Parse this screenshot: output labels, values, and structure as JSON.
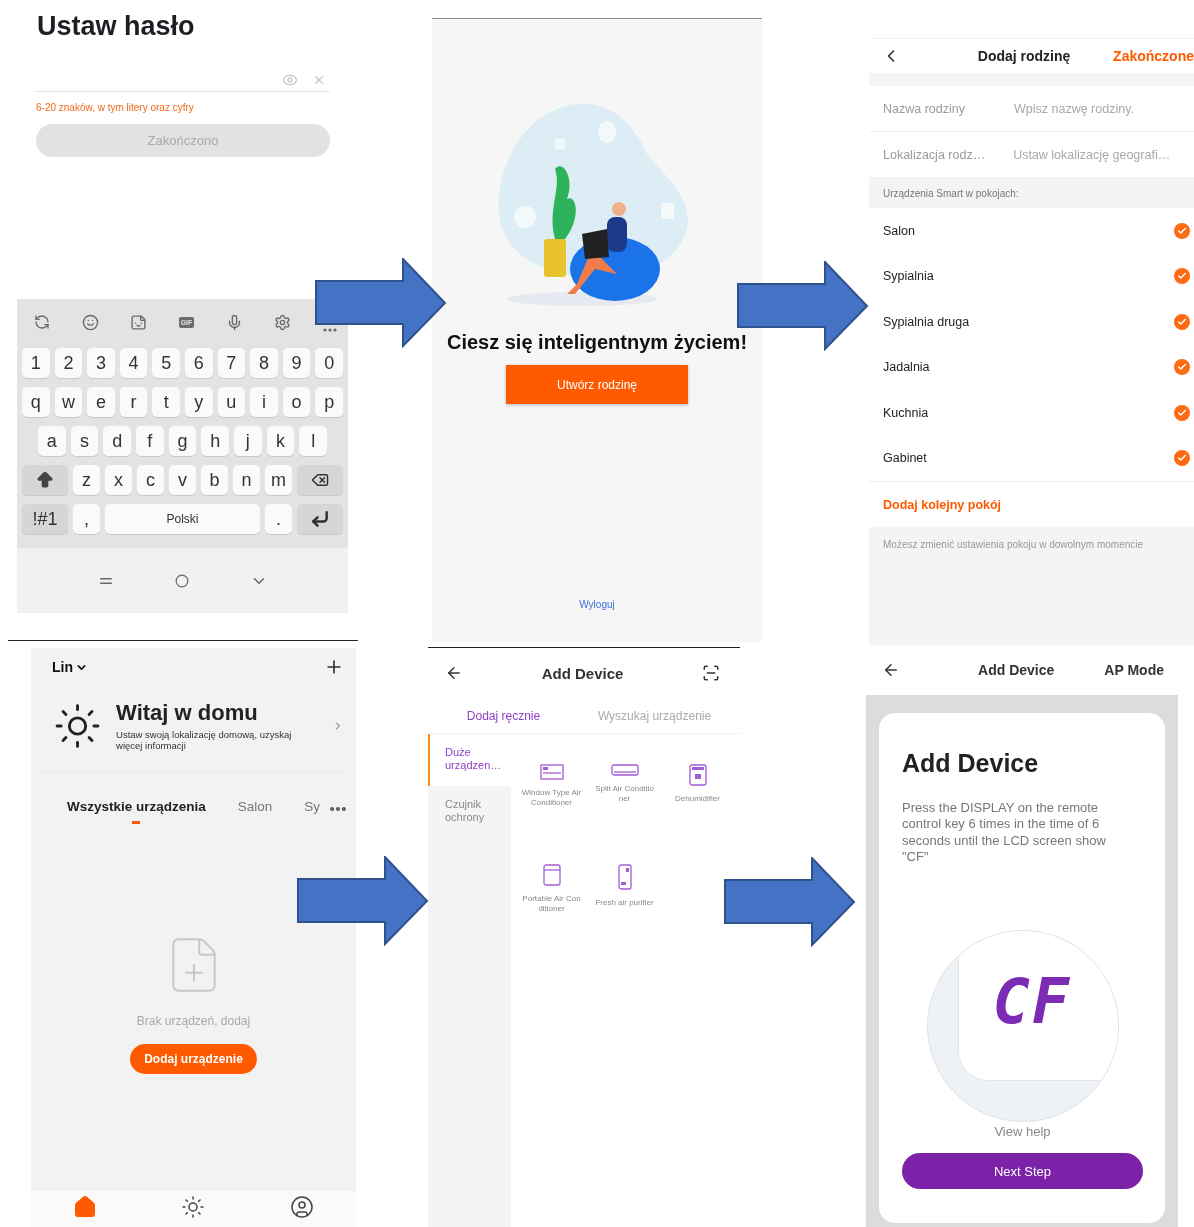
{
  "password_screen": {
    "title": "Ustaw hasło",
    "hint": "6-20 znaków, w tym litery oraz cyfry",
    "button": {
      "label": "Zakończono",
      "disabled": true
    }
  },
  "keyboard": {
    "gif_label": "GIF",
    "rows": [
      [
        "1",
        "2",
        "3",
        "4",
        "5",
        "6",
        "7",
        "8",
        "9",
        "0"
      ],
      [
        "q",
        "w",
        "e",
        "r",
        "t",
        "y",
        "u",
        "i",
        "o",
        "p"
      ],
      [
        "a",
        "s",
        "d",
        "f",
        "g",
        "h",
        "j",
        "k",
        "l"
      ],
      [
        "z",
        "x",
        "c",
        "v",
        "b",
        "n",
        "m"
      ]
    ],
    "bottom_row": {
      "symbols": "!#1",
      "comma": ",",
      "space": "Polski",
      "period": "."
    }
  },
  "welcome_screen": {
    "title": "Ciesz się inteligentnym życiem!",
    "button": "Utwórz rodzinę",
    "logout_link": "Wyloguj"
  },
  "family_setup": {
    "title": "Dodaj rodzinę",
    "done": "Zakończone",
    "fields": [
      {
        "label": "Nazwa rodziny",
        "placeholder": "Wpisz nazwę rodziny."
      },
      {
        "label": "Lokalizacja rodz…",
        "placeholder": "Ustaw lokalizację geografi…"
      }
    ],
    "rooms_heading": "Urządzenia Smart w pokojach:",
    "rooms": [
      {
        "name": "Salon",
        "checked": true
      },
      {
        "name": "Sypialnia",
        "checked": true
      },
      {
        "name": "Sypialnia druga",
        "checked": true
      },
      {
        "name": "Jadalnia",
        "checked": true
      },
      {
        "name": "Kuchnia",
        "checked": true
      },
      {
        "name": "Gabinet",
        "checked": true
      }
    ],
    "add_room": "Dodaj kolejny pokój",
    "note": "Możesz zmienić ustawienia pokoju w dowolnym momencie"
  },
  "home_screen": {
    "home_name": "Lin",
    "title": "Witaj w domu",
    "subtitle": "Ustaw swoją lokalizację domową, uzyskaj więcej informacji",
    "tabs": [
      {
        "label": "Wszystkie urządzenia",
        "selected": true
      },
      {
        "label": "Salon",
        "selected": false
      },
      {
        "label": "Sy",
        "selected": false
      }
    ],
    "empty_text": "Brak urządzeń, dodaj",
    "button": "Dodaj urządzenie"
  },
  "device_list": {
    "title": "Add Device",
    "tabs": [
      {
        "label": "Dodaj ręcznie",
        "selected": true
      },
      {
        "label": "Wyszukaj urządzenie",
        "selected": false
      }
    ],
    "categories": [
      {
        "label": "Duże urządzen…",
        "selected": true
      },
      {
        "label": "Czujnik ochrony",
        "selected": false
      }
    ],
    "devices": [
      {
        "kind": "window_ac",
        "label": "Window Type Air Conditioner"
      },
      {
        "kind": "split_ac",
        "label": "Split Air Conditioner"
      },
      {
        "kind": "dehumidifier",
        "label": "Dehumidifier"
      },
      {
        "kind": "portable_ac",
        "label": "Portable Air Conditioner"
      },
      {
        "kind": "air_purifier",
        "label": "Fresh air purifier"
      }
    ]
  },
  "ap_mode": {
    "title": "Add Device",
    "mode": "AP Mode",
    "card_title": "Add Device",
    "instructions": "Press the DISPLAY on the remote control key 6 times in the time of 6 seconds until the LCD screen show \"CF\"",
    "lcd_text": "CF",
    "help_link": "View help",
    "button": "Next Step"
  }
}
